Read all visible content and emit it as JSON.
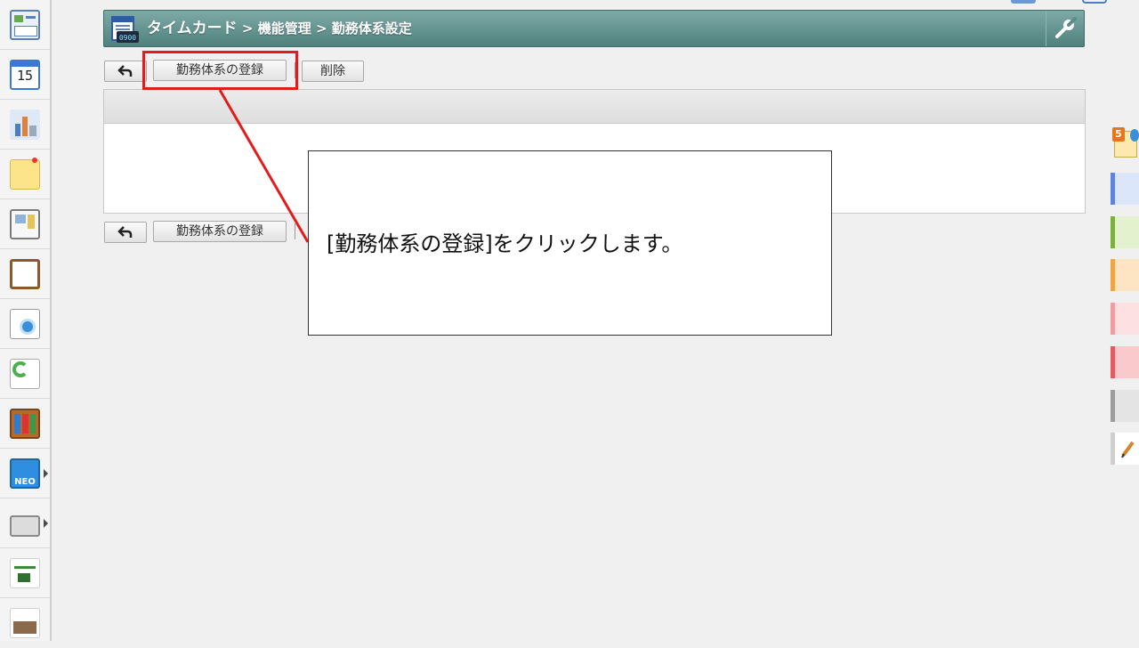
{
  "header": {
    "title": "タイムカード",
    "breadcrumb_sep": ">",
    "crumb_2": "機能管理",
    "crumb_3": "勤務体系設定",
    "app_icon_text": "0900"
  },
  "toolbar_top": {
    "back_label": "",
    "register_label": "勤務体系の登録",
    "delete_label": "削除"
  },
  "toolbar_bottom": {
    "back_label": "",
    "register_label": "勤務体系の登録"
  },
  "callout": {
    "text": "[勤務体系の登録]をクリックします。",
    "border_color": "#e31b1b"
  },
  "sidebar": {
    "items": [
      {
        "icon": "portal-icon"
      },
      {
        "icon": "calendar-icon",
        "label": "15"
      },
      {
        "icon": "facility-icon"
      },
      {
        "icon": "memo-icon"
      },
      {
        "icon": "bulletin-board-icon"
      },
      {
        "icon": "clipboard-icon"
      },
      {
        "icon": "survey-icon"
      },
      {
        "icon": "workflow-icon"
      },
      {
        "icon": "binder-icon"
      },
      {
        "icon": "neo-icon",
        "label": "NEO"
      },
      {
        "icon": "folder-icon"
      },
      {
        "icon": "banner-icon-1"
      },
      {
        "icon": "banner-icon-2"
      }
    ]
  },
  "right_palette": {
    "badge": "5",
    "tabs": [
      {
        "name": "blue-tab",
        "color": "#5b86e5"
      },
      {
        "name": "green-tab",
        "color": "#7bb334"
      },
      {
        "name": "orange-tab",
        "color": "#f5a43b"
      },
      {
        "name": "pink-tab",
        "color": "#f49aa0"
      },
      {
        "name": "red-tab",
        "color": "#e9575f"
      },
      {
        "name": "gray-tab",
        "color": "#9c9c9c"
      }
    ]
  },
  "colors": {
    "header_teal": "#5b8c88",
    "highlight_red": "#e31b1b"
  }
}
